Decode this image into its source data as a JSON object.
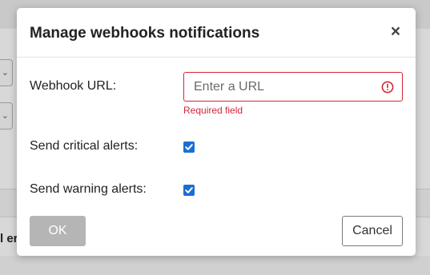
{
  "background": {
    "partial_text": "l er"
  },
  "modal": {
    "title": "Manage webhooks notifications",
    "close_glyph": "×",
    "webhook_url": {
      "label": "Webhook URL:",
      "placeholder": "Enter a URL",
      "value": "",
      "error": "Required field",
      "error_color": "#d3263a"
    },
    "critical": {
      "label": "Send critical alerts:",
      "checked": true
    },
    "warning": {
      "label": "Send warning alerts:",
      "checked": true
    },
    "ok_label": "OK",
    "cancel_label": "Cancel",
    "accent": "#1a6fd3"
  }
}
